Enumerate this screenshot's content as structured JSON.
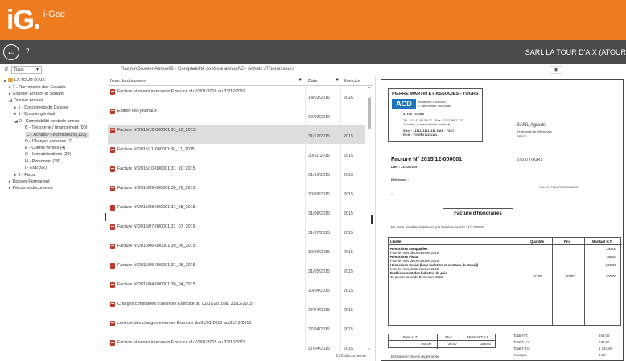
{
  "header": {
    "logo_letter1": "i",
    "logo_letter2": "G",
    "app_name": "i-Ged"
  },
  "toolbar": {
    "back_icon": "back-arrow-circle-icon",
    "help_label": "?",
    "company": "SARL LA TOUR D'AIX (ATOUR"
  },
  "subbar": {
    "filter_value": "Tous",
    "breadcrumb": "Racine\\Dossier Annuel\\2 - Comptabilité controle annuel\\C - Achats / Fournisseurs"
  },
  "tree": [
    {
      "label": "LA TOUR D'AIX",
      "level": 0,
      "toggle": "◢",
      "folder": true
    },
    {
      "label": "2 - Documents des Salariés",
      "level": 1,
      "toggle": "▸"
    },
    {
      "label": "Courrier Entrant et Sortant",
      "level": 1,
      "toggle": "▸"
    },
    {
      "label": "Dossier Annuel",
      "level": 1,
      "toggle": "◢"
    },
    {
      "label": "1 - Documents du Dossier",
      "level": 2,
      "toggle": "▸"
    },
    {
      "label": "1 - Dossier général",
      "level": 2,
      "toggle": "▸"
    },
    {
      "label": "2 - Comptabilité controle annuel",
      "level": 2,
      "toggle": "◢"
    },
    {
      "label": "B - Trésorerie / financement (90)",
      "level": 3,
      "toggle": ""
    },
    {
      "label": "C - Achats / Fournisseurs (133)",
      "level": 3,
      "toggle": "",
      "selected": true
    },
    {
      "label": "D - Charges externes (7)",
      "level": 3,
      "toggle": ""
    },
    {
      "label": "E - Clients ventes (4)",
      "level": 3,
      "toggle": ""
    },
    {
      "label": "G - Immobilisations (20)",
      "level": 3,
      "toggle": ""
    },
    {
      "label": "H - Personnel (38)",
      "level": 3,
      "toggle": ""
    },
    {
      "label": "I - Etat (62)",
      "level": 3,
      "toggle": ""
    },
    {
      "label": "3 - Fiscal",
      "level": 2,
      "toggle": "▸"
    },
    {
      "label": "Dossier Permanent",
      "level": 1,
      "toggle": "▸"
    },
    {
      "label": "Pièces et documents",
      "level": 1,
      "toggle": "▸"
    }
  ],
  "list": {
    "col_name": "Nom du document",
    "col_date": "Date",
    "col_exercise": "Exercice",
    "count": "133 documents",
    "rows": [
      {
        "name": "Facture et avoirs à recevoir Exercice du 01/01/2016 au 31/12/2016",
        "date": "14/03/2016",
        "exercise": "2016"
      },
      {
        "name": "Edition des journaux",
        "date": "02/03/2016",
        "exercise": ""
      },
      {
        "name": "Facture N°2015/12-000001 31_12_2015",
        "date": "31/12/2015",
        "exercise": "2015",
        "selected": true
      },
      {
        "name": "Facture N°2015/11-000001 30_11_2015",
        "date": "30/11/2015",
        "exercise": "2015"
      },
      {
        "name": "Facture N°2015/10-000001 31_10_2015",
        "date": "31/10/2015",
        "exercise": "2015"
      },
      {
        "name": "Facture N°2015/09-000001 30_09_2015",
        "date": "30/09/2015",
        "exercise": "2015"
      },
      {
        "name": "Facture N°2015/08-000001 31_08_2015",
        "date": "31/08/2015",
        "exercise": "2015"
      },
      {
        "name": "Facture N°2015/07-000001 31_07_2015",
        "date": "31/07/2015",
        "exercise": "2015"
      },
      {
        "name": "Facture N°2015/06-000001 30_06_2015",
        "date": "30/06/2015",
        "exercise": "2015"
      },
      {
        "name": "Facture N°2015/05-000001 31_05_2015",
        "date": "31/05/2015",
        "exercise": "2015"
      },
      {
        "name": "Facture N°2015/04-000001 30_04_2015",
        "date": "30/04/2015",
        "exercise": "2015"
      },
      {
        "name": "Charges constatées d'avances Exercice du 01/01/2015 au 31/12/2015",
        "date": "27/04/2015",
        "exercise": "2015"
      },
      {
        "name": "controle des charges externes Exercice du 01/01/2015 au 31/12/2015",
        "date": "27/04/2015",
        "exercise": "2015"
      },
      {
        "name": "Facture et avoirs à recevoir Exercice du 01/01/2015 au 31/12/2015",
        "date": "27/04/2015",
        "exercise": "2015"
      }
    ]
  },
  "preview": {
    "view_icon": "eye-icon",
    "issuer": "PIERRE MARTIN ET ASSOCIES - TOURS",
    "logo": "ACD",
    "issuer_addr1": "Immeuble CREATIC",
    "issuer_addr2": "2, rue Robert Schuman",
    "issuer_city": "37100 TOURS",
    "issuer_tel": "Tel. : 02 47 88 59 22   - Fax: 02 51 98 12 22",
    "issuer_mail": "Courriel : p.martin@cab-martin.fr",
    "issuer_siret": "Siret : 11111111111111          NAF : 741C",
    "issuer_rcs": "RCS : TOURS B111111",
    "client_name": "SARL Agrods",
    "client_addr": "63 Avenue de Villeneuve",
    "client_bp": "BP 501",
    "client_city": "37100 TOURS",
    "invoice_no": "Facture N° 2015/12-000001",
    "invoice_date": "Date : 31/12/2015",
    "reference": "Référence :",
    "vat_no": "Votre N° TVA FR99079685547",
    "honoraires_title": "Facture d'honoraires",
    "payment_note": "En votre aimable règlement par Prélèvement le 31/12/2015",
    "table_head": {
      "libelle": "Libellé",
      "qte": "Quantité",
      "prix": "Prix",
      "montant": "Montant H.T."
    },
    "lines": [
      "Honoraires comptables",
      "Pour le mois de Décembre 2015",
      "Honoraires Fiscal",
      "Pour le mois de Décembre 2015",
      "Honoraires Social (hors bulletins et contrats de travail)",
      "Pour le mois de Décembre 2015",
      "Etablissement des bulletins de paie",
      "10 pour le mois de  Décembre 2015"
    ],
    "amounts": [
      "330,00",
      "195,00",
      "220,00",
      "200,00"
    ],
    "qty": "10,00",
    "price": "20,00",
    "tva_head": {
      "base": "Base H.T.",
      "taux": "Taux",
      "montant": "Montant T.V.A."
    },
    "tva_row": {
      "base": "948,00",
      "taux": "20,00",
      "montant": "189,60"
    },
    "totals": [
      {
        "label": "Total H.T.",
        "value": "948,00"
      },
      {
        "label": "Total T.V.A.",
        "value": "189,60"
      },
      {
        "label": "Total T.T.C.",
        "value": "1 137,60"
      },
      {
        "label": "Acompte",
        "value": "0,00"
      }
    ],
    "footer_partial": "Echéancier de vos règlements"
  }
}
